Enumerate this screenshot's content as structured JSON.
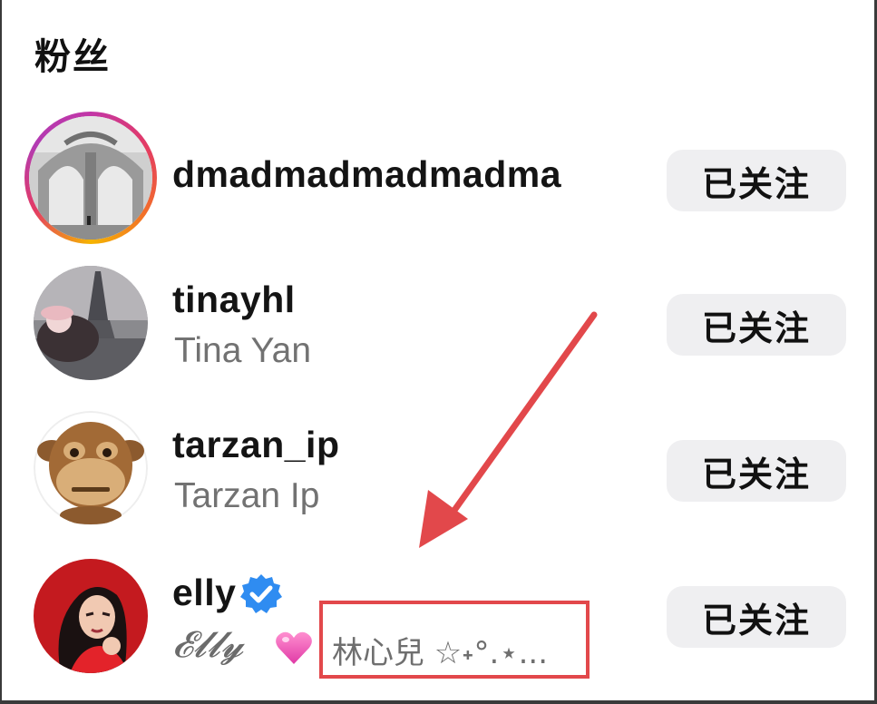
{
  "page": {
    "title": "粉丝"
  },
  "followers": [
    {
      "username": "dmadmadmadmadma",
      "fullname": "",
      "button_label": "已关注",
      "avatar_icon": "avatar-architecture-photo",
      "has_story_ring": true
    },
    {
      "username": "tinayhl",
      "fullname": "Tina Yan",
      "button_label": "已关注",
      "avatar_icon": "avatar-eiffel-tower-photo",
      "has_story_ring": false
    },
    {
      "username": "tarzan_ip",
      "fullname": "Tarzan Ip",
      "button_label": "已关注",
      "avatar_icon": "avatar-monkey-emoji",
      "has_story_ring": false
    },
    {
      "username": "elly",
      "fullname_script": "𝓔𝓵𝓵𝔂",
      "fullname_emoji": "heart-emoji",
      "fullname_chinese": "林心兒 ☆˖°.⋆...",
      "button_label": "已关注",
      "avatar_icon": "avatar-red-portrait-photo",
      "verified": true,
      "verified_icon": "verified-badge-icon"
    }
  ],
  "annotation": {
    "arrow_color": "#e2484b",
    "box_color": "#e2484b"
  }
}
